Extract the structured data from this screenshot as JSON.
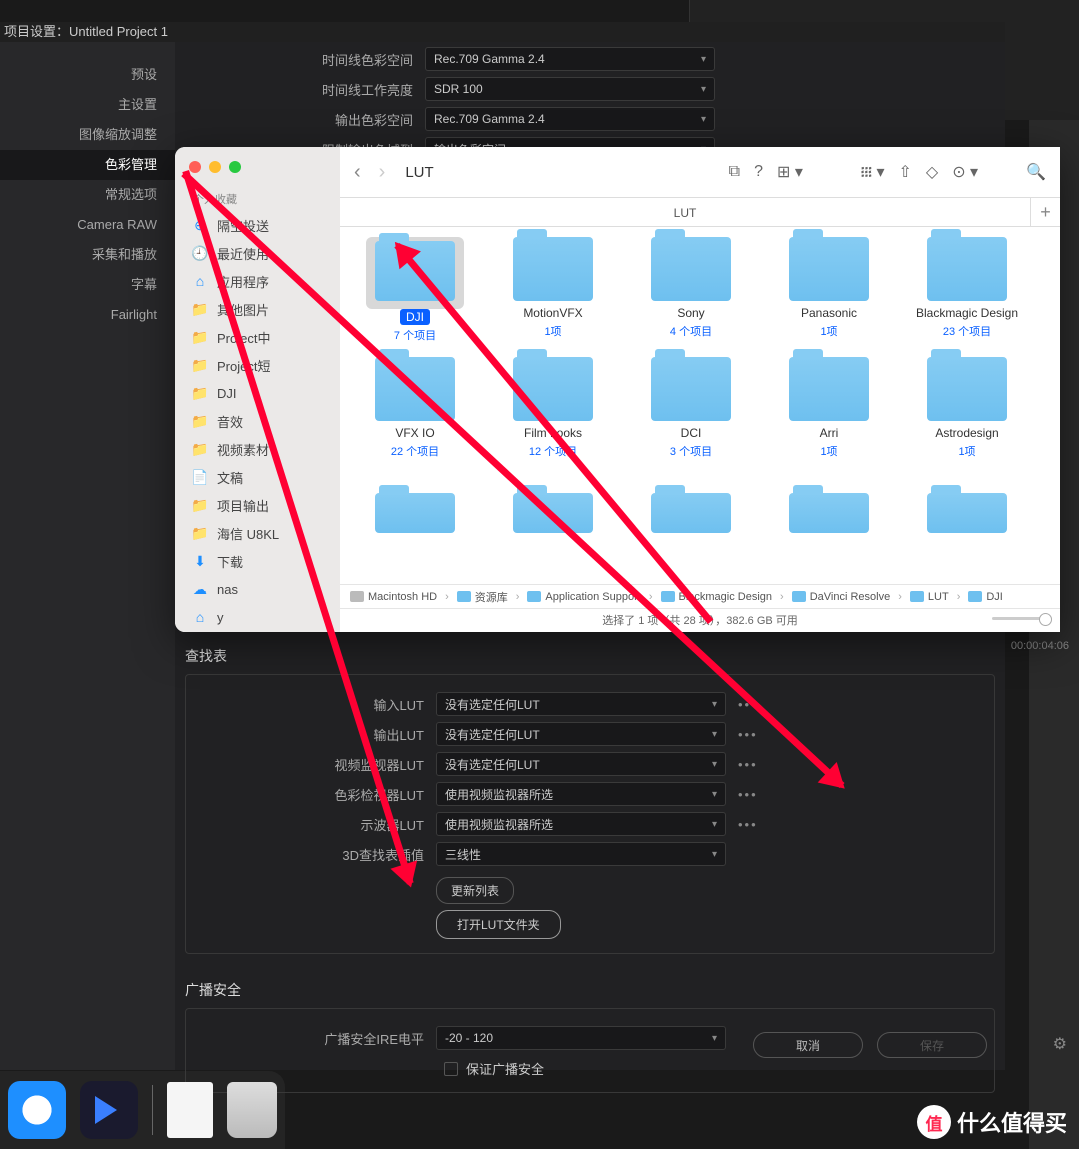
{
  "title_bar": "项目设置：Untitled Project 1",
  "sidebar": {
    "items": [
      "预设",
      "主设置",
      "图像缩放调整",
      "色彩管理",
      "常规选项",
      "Camera RAW",
      "采集和播放",
      "字幕",
      "Fairlight"
    ],
    "active_index": 3
  },
  "top_form": {
    "rows": [
      {
        "label": "时间线色彩空间",
        "value": "Rec.709 Gamma 2.4"
      },
      {
        "label": "时间线工作亮度",
        "value": "SDR 100"
      },
      {
        "label": "输出色彩空间",
        "value": "Rec.709 Gamma 2.4"
      },
      {
        "label": "限制输出色域到",
        "value": "输出色彩空间"
      }
    ]
  },
  "lut_section": {
    "header": "查找表",
    "rows": [
      {
        "label": "输入LUT",
        "value": "没有选定任何LUT",
        "dots": true
      },
      {
        "label": "输出LUT",
        "value": "没有选定任何LUT",
        "dots": true
      },
      {
        "label": "视频监视器LUT",
        "value": "没有选定任何LUT",
        "dots": true
      },
      {
        "label": "色彩检视器LUT",
        "value": "使用视频监视器所选",
        "dots": true
      },
      {
        "label": "示波器LUT",
        "value": "使用视频监视器所选",
        "dots": true
      },
      {
        "label": "3D查找表插值",
        "value": "三线性",
        "dots": false
      }
    ],
    "btn_update": "更新列表",
    "btn_open": "打开LUT文件夹"
  },
  "broadcast": {
    "header": "广播安全",
    "label": "广播安全IRE电平",
    "value": "-20 - 120",
    "checkbox": "保证广播安全"
  },
  "footer": {
    "cancel": "取消",
    "save": "保存"
  },
  "timecode": "00:00:04:06",
  "finder": {
    "title": "LUT",
    "tab": "LUT",
    "fav_header": "个人收藏",
    "sidebar_items": [
      {
        "icon": "⊕",
        "label": "隔空投送"
      },
      {
        "icon": "🕘",
        "label": "最近使用"
      },
      {
        "icon": "⌂",
        "label": "应用程序"
      },
      {
        "icon": "📁",
        "label": "其他图片"
      },
      {
        "icon": "📁",
        "label": "Project中"
      },
      {
        "icon": "📁",
        "label": "Project短"
      },
      {
        "icon": "📁",
        "label": "DJI"
      },
      {
        "icon": "📁",
        "label": "音效"
      },
      {
        "icon": "📁",
        "label": "视频素材"
      },
      {
        "icon": "📄",
        "label": "文稿"
      },
      {
        "icon": "📁",
        "label": "项目输出"
      },
      {
        "icon": "📁",
        "label": "海信 U8KL"
      },
      {
        "icon": "⬇",
        "label": "下载"
      },
      {
        "icon": "☁",
        "label": "nas"
      },
      {
        "icon": "⌂",
        "label": "y"
      }
    ],
    "folders": [
      {
        "name": "DJI",
        "count": "7 个项目",
        "selected": true
      },
      {
        "name": "MotionVFX",
        "count": "1项"
      },
      {
        "name": "Sony",
        "count": "4 个项目"
      },
      {
        "name": "Panasonic",
        "count": "1项"
      },
      {
        "name": "Blackmagic Design",
        "count": "23 个项目"
      },
      {
        "name": "VFX IO",
        "count": "22 个项目"
      },
      {
        "name": "Film Looks",
        "count": "12 个项目"
      },
      {
        "name": "DCI",
        "count": "3 个项目"
      },
      {
        "name": "Arri",
        "count": "1项"
      },
      {
        "name": "Astrodesign",
        "count": "1项"
      }
    ],
    "folders_row3": [
      "",
      "",
      "",
      "",
      ""
    ],
    "path": [
      "Macintosh HD",
      "资源库",
      "Application Support",
      "Blackmagic Design",
      "DaVinci Resolve",
      "LUT",
      "DJI"
    ],
    "status": "选择了 1 项（共 28 项），382.6 GB 可用"
  },
  "watermark": {
    "badge": "值",
    "text": "什么值得买"
  }
}
